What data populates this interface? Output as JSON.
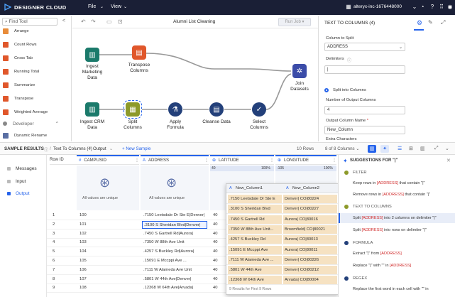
{
  "topbar": {
    "brand": "DESIGNER CLOUD",
    "menu_file": "File",
    "menu_view": "View",
    "account": "alteryx-inc-1676448000",
    "chev": "⌄"
  },
  "left": {
    "find_tool": "Find Tool",
    "tools": [
      "Arrange",
      "Count Rows",
      "Cross Tab",
      "Running Total",
      "Summarize",
      "Transpose",
      "Weighted Average"
    ],
    "developer": "Developer",
    "dynamic_rename": "Dynamic Rename"
  },
  "toolbar": {
    "recipe_name": "Alumni List Cleaning",
    "run_label": "Run Job"
  },
  "canvas": {
    "nodes": {
      "ingest_marketing": "Ingest\nMarketing\nData",
      "transpose": "Transpose\nColumns",
      "ingest_crm": "Ingest CRM\nData",
      "split": "Split\nColumns",
      "apply": "Apply\nFormula",
      "cleanse": "Cleanse Data",
      "select": "Select\nColumns",
      "join": "Join\nDatasets"
    }
  },
  "right": {
    "title": "TEXT TO COLUMNS (4)",
    "column_to_split_label": "Column to Split",
    "column_to_split_value": "ADDRESS",
    "delimiters_label": "Delimiters",
    "delimiter_value": "|",
    "split_into_columns": "Split into Columns",
    "num_output_label": "Number of Output Columns",
    "num_output_value": "4",
    "output_name_label": "Output Column Name",
    "req": "*",
    "output_name_value": "New_Column",
    "extra_chars_label": "Extra Characters"
  },
  "sample": {
    "label": "SAMPLE RESULTS",
    "path1": "Text To Columns (4)",
    "sep": "/",
    "path2": "Output",
    "new_sample": "New Sample",
    "rows": "10 Rows",
    "columns": "8 of 8 Columns"
  },
  "bottom_nav": [
    "Messages",
    "Input",
    "Output"
  ],
  "grid": {
    "row_id_header": "Row ID",
    "columns": [
      "CAMPUSID",
      "ADDRESS",
      "LATITUDE",
      "LONGITUDE"
    ],
    "lat_range": [
      "40",
      "100%"
    ],
    "lon_range": [
      "-105",
      "100%"
    ],
    "unique_note": "All values are unique",
    "rows": [
      {
        "id": "1",
        "campus": "100",
        "address": ".7150 Leetsdale Dr Ste E|Denver|",
        "lat": "40"
      },
      {
        "id": "2",
        "campus": "101",
        "address": ".3100 S Sheridan Blvd|Denver|",
        "lat": "40"
      },
      {
        "id": "3",
        "campus": "102",
        "address": ".7450 S Gartrell Rd|Aurora|",
        "lat": "40"
      },
      {
        "id": "4",
        "campus": "103",
        "address": ".7350 W 88th Ave Unit",
        "lat": "40"
      },
      {
        "id": "5",
        "campus": "104",
        "address": ".4257 S Buckley Rd|Aurora|",
        "lat": "40"
      },
      {
        "id": "6",
        "campus": "105",
        "address": ".15091 E Mccppi Ave ...",
        "lat": "40"
      },
      {
        "id": "7",
        "campus": "106",
        "address": ".7111 W Alameda Ave Unit",
        "lat": "40"
      },
      {
        "id": "8",
        "campus": "107",
        "address": ".5801 W 44th Ave|Denver|",
        "lat": "40"
      },
      {
        "id": "9",
        "campus": "108",
        "address": ".12368 W 64th Ave|Arvada|",
        "lat": "40"
      }
    ]
  },
  "popup": {
    "headers": [
      "New_Column1",
      "New_Column2"
    ],
    "rows": [
      [
        ".7150 Leetsdale Dr Ste E",
        "Denver| CO|80224"
      ],
      [
        ".3100 S Sheridan Blvd",
        "Denver| CO|80227"
      ],
      [
        ".7450 S Gartrell Rd",
        "Aurora| CO|80016"
      ],
      [
        ".7350 W 88th Ave Unit...",
        "Broomfield| CO|80021"
      ],
      [
        ".4257 S Buckley Rd",
        "Aurora| CO|80013"
      ],
      [
        ".15091 E Mccppi Ave",
        "Aurora| CO|80011"
      ],
      [
        ".7111 W Alameda Ave ...",
        "Denver| CO|80226"
      ],
      [
        ".5801 W 44th Ave",
        "Denver| CO|80212"
      ],
      [
        ".12368 W 64th Ave",
        "Arvada| CO|80004"
      ]
    ],
    "footer": "9 Results for First 9 Rows"
  },
  "sugg": {
    "title": "SUGGESTIONS FOR \"|\"",
    "filter": "FILTER",
    "filter_items": [
      [
        "Keep rows in ",
        "[ADDRESS]",
        " that contain \"|\""
      ],
      [
        "Remove rows in ",
        "[ADDRESS]",
        " that contain \"|\""
      ]
    ],
    "ttc": "TEXT TO COLUMNS",
    "ttc_items": [
      [
        "Split ",
        "[ADDRESS]",
        " into 2 columns on delimiter \"|\""
      ],
      [
        "Split ",
        "[ADDRESS]",
        " into rows on delimiter \"|\""
      ]
    ],
    "formula": "FORMULA",
    "formula_items": [
      [
        "Extract \"|\" from ",
        "[ADDRESS]",
        ""
      ],
      [
        "Replace \"|\" with \"\" in ",
        "[ADDRESS]",
        ""
      ]
    ],
    "regex": "REGEX",
    "regex_item": "Replace the first word in each cell with \"\" in"
  },
  "colors": {
    "topbar": "#1a1f36",
    "accent": "#2563eb",
    "teal": "#1b7a6b",
    "orange": "#e0572b",
    "green": "#7a8a3a",
    "navy": "#23407a"
  }
}
